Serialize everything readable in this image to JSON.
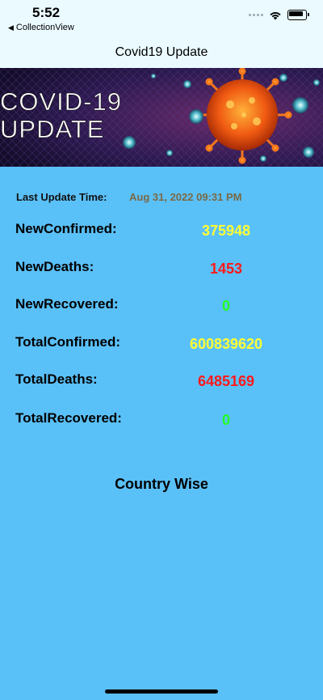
{
  "status": {
    "time": "5:52",
    "back_label": "CollectionView"
  },
  "nav": {
    "title": "Covid19 Update"
  },
  "banner": {
    "line1": "COVID-19",
    "line2": "UPDATE"
  },
  "last_update": {
    "label": "Last Update Time:",
    "value": "Aug 31, 2022 09:31 PM"
  },
  "stats": [
    {
      "label": "NewConfirmed:",
      "value": "375948",
      "color": "#ffff33"
    },
    {
      "label": "NewDeaths:",
      "value": "1453",
      "color": "#ff1a1a"
    },
    {
      "label": "NewRecovered:",
      "value": "0",
      "color": "#22ff22"
    },
    {
      "label": "TotalConfirmed:",
      "value": "600839620",
      "color": "#ffff33"
    },
    {
      "label": "TotalDeaths:",
      "value": "6485169",
      "color": "#ff1a1a"
    },
    {
      "label": "TotalRecovered:",
      "value": "0",
      "color": "#22ff22"
    }
  ],
  "country_wise_label": "Country Wise",
  "colors": {
    "background": "#5ac0f8",
    "header_bg": "#eafaff",
    "timestamp": "#7a6a45"
  }
}
